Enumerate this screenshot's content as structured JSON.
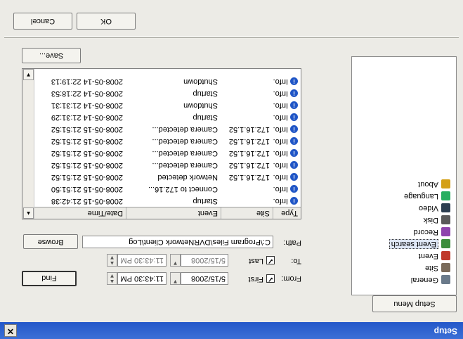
{
  "window": {
    "title": "Setup",
    "close_glyph": "✕"
  },
  "left_tab": {
    "label": "Setup Menu"
  },
  "tree": [
    {
      "label": "General",
      "icon": "general-icon",
      "color": "#6a7a8a"
    },
    {
      "label": "Site",
      "icon": "site-icon",
      "color": "#7a6a5a"
    },
    {
      "label": "Event",
      "icon": "event-icon",
      "color": "#c0392b"
    },
    {
      "label": "Event search",
      "icon": "event-search-icon",
      "color": "#3c8d3c",
      "selected": true
    },
    {
      "label": "Record",
      "icon": "record-icon",
      "color": "#8e44ad"
    },
    {
      "label": "Disk",
      "icon": "disk-icon",
      "color": "#5a5a5a"
    },
    {
      "label": "Video",
      "icon": "video-icon",
      "color": "#2c3e50"
    },
    {
      "label": "Language",
      "icon": "language-icon",
      "color": "#27ae60"
    },
    {
      "label": "About",
      "icon": "about-icon",
      "color": "#d4a017"
    }
  ],
  "search": {
    "from_label": "From:",
    "to_label": "To:",
    "first_label": "First",
    "last_label": "Last",
    "from_date": "5/15/2008",
    "from_time": "11:43:30 PM",
    "to_date": "5/15/2008",
    "to_time": "11:43:30 PM",
    "find_label": "Find",
    "path_label": "Path:",
    "path_value": "C:\\Program Files\\DVRNetwork Client\\Log",
    "browse_label": "Browse"
  },
  "table": {
    "columns": [
      "Type",
      "Site",
      "Event",
      "Date/Time"
    ],
    "rows": [
      {
        "type": "Info.",
        "site": "",
        "event": "Startup",
        "datetime": "2008-05-15 21:42:38"
      },
      {
        "type": "Info.",
        "site": "",
        "event": "Connect to 172.16...",
        "datetime": "2008-05-15 21:51:50"
      },
      {
        "type": "Info.",
        "site": "172.16.1.52",
        "event": "Network detected",
        "datetime": "2008-05-15 21:51:52"
      },
      {
        "type": "Info.",
        "site": "172.16.1.52",
        "event": "Camera detected...",
        "datetime": "2008-05-15 21:51:52"
      },
      {
        "type": "Info.",
        "site": "172.16.1.52",
        "event": "Camera detected...",
        "datetime": "2008-05-15 21:51:52"
      },
      {
        "type": "Info.",
        "site": "172.16.1.52",
        "event": "Camera detected...",
        "datetime": "2008-05-15 21:51:52"
      },
      {
        "type": "Info.",
        "site": "172.16.1.52",
        "event": "Camera detected...",
        "datetime": "2008-05-15 21:51:52"
      },
      {
        "type": "Info.",
        "site": "",
        "event": "Startup",
        "datetime": "2008-05-14 21:31:29"
      },
      {
        "type": "Info.",
        "site": "",
        "event": "Shutdown",
        "datetime": "2008-05-14 21:31:31"
      },
      {
        "type": "Info.",
        "site": "",
        "event": "Startup",
        "datetime": "2008-05-14 22:18:53"
      },
      {
        "type": "Info.",
        "site": "",
        "event": "Shutdown",
        "datetime": "2008-05-14 22:19:13"
      }
    ]
  },
  "save_label": "Save...",
  "ok_label": "OK",
  "cancel_label": "Cancel"
}
